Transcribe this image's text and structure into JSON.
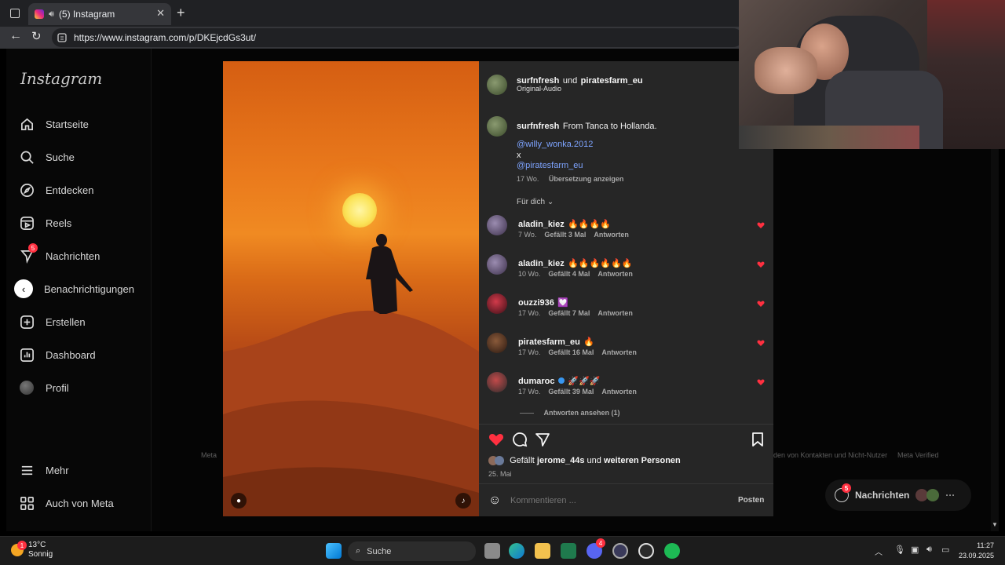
{
  "browser": {
    "tab_title": "(5) Instagram",
    "url": "https://www.instagram.com/p/DKEjcdGs3ut/"
  },
  "sidebar": {
    "logo": "Instagram",
    "items": [
      {
        "label": "Startseite",
        "icon": "home-icon"
      },
      {
        "label": "Suche",
        "icon": "search-icon"
      },
      {
        "label": "Entdecken",
        "icon": "compass-icon"
      },
      {
        "label": "Reels",
        "icon": "reels-icon"
      },
      {
        "label": "Nachrichten",
        "icon": "messenger-icon",
        "badge": "5"
      },
      {
        "label": "Benachrichtigungen",
        "icon": "heart-icon"
      },
      {
        "label": "Erstellen",
        "icon": "plus-square-icon"
      },
      {
        "label": "Dashboard",
        "icon": "dashboard-icon"
      },
      {
        "label": "Profil",
        "icon": "avatar"
      }
    ],
    "more": "Mehr",
    "meta": "Auch von Meta"
  },
  "post": {
    "header_user1": "surfnfresh",
    "header_and": "und",
    "header_user2": "piratesfarm_eu",
    "audio": "Original-Audio",
    "caption_user": "surfnfresh",
    "caption_text": "From Tanca to Hollanda.",
    "mention1": "@willy_wonka.2012",
    "x": "x",
    "mention2": "@piratesfarm_eu",
    "caption_age": "17 Wo.",
    "translate": "Übersetzung anzeigen",
    "for_you": "Für dich",
    "comments": [
      {
        "user": "aladin_kiez",
        "text": "🔥🔥🔥🔥",
        "age": "7 Wo.",
        "likes": "Gefällt 3 Mal",
        "reply": "Antworten"
      },
      {
        "user": "aladin_kiez",
        "text": "🔥🔥🔥🔥🔥🔥",
        "age": "10 Wo.",
        "likes": "Gefällt 4 Mal",
        "reply": "Antworten"
      },
      {
        "user": "ouzzi936",
        "text": "💟",
        "age": "17 Wo.",
        "likes": "Gefällt 7 Mal",
        "reply": "Antworten"
      },
      {
        "user": "piratesfarm_eu",
        "text": "🔥",
        "age": "17 Wo.",
        "likes": "Gefällt 16 Mal",
        "reply": "Antworten"
      },
      {
        "user": "dumaroc",
        "text": "🚀🚀🚀",
        "age": "17 Wo.",
        "likes": "Gefällt 39 Mal",
        "reply": "Antworten"
      }
    ],
    "view_replies": "Antworten ansehen (1)",
    "liked_prefix": "Gefällt",
    "liked_user": "jerome_44s",
    "liked_and": "und",
    "liked_rest": "weiteren Personen",
    "date": "25. Mai",
    "comment_placeholder": "Kommentieren ...",
    "post_button": "Posten"
  },
  "footer": {
    "left": "Meta",
    "right1": "den von Kontakten und Nicht-Nutzer",
    "right2": "Meta Verified"
  },
  "messages_pill": {
    "label": "Nachrichten",
    "badge": "5"
  },
  "taskbar": {
    "weather_temp": "13°C",
    "weather_desc": "Sonnig",
    "weather_badge": "1",
    "search": "Suche",
    "discord_badge": "4",
    "time": "11:27",
    "date": "23.09.2025"
  },
  "colors": {
    "like_red": "#ff3040",
    "link_blue": "#7ea4ff",
    "panel_bg": "#262626"
  }
}
